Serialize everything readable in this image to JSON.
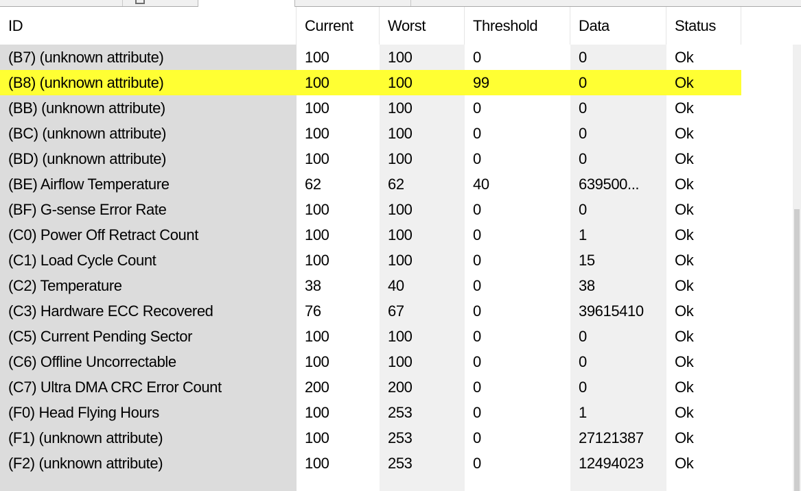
{
  "columns": [
    "ID",
    "Current",
    "Worst",
    "Threshold",
    "Data",
    "Status"
  ],
  "rows": [
    {
      "id": "(B7) (unknown attribute)",
      "current": "100",
      "worst": "100",
      "threshold": "0",
      "data": "0",
      "status": "Ok"
    },
    {
      "id": "(B8) (unknown attribute)",
      "current": "100",
      "worst": "100",
      "threshold": "99",
      "data": "0",
      "status": "Ok"
    },
    {
      "id": "(BB) (unknown attribute)",
      "current": "100",
      "worst": "100",
      "threshold": "0",
      "data": "0",
      "status": "Ok"
    },
    {
      "id": "(BC) (unknown attribute)",
      "current": "100",
      "worst": "100",
      "threshold": "0",
      "data": "0",
      "status": "Ok"
    },
    {
      "id": "(BD) (unknown attribute)",
      "current": "100",
      "worst": "100",
      "threshold": "0",
      "data": "0",
      "status": "Ok"
    },
    {
      "id": "(BE) Airflow Temperature",
      "current": "62",
      "worst": "62",
      "threshold": "40",
      "data": "639500...",
      "status": "Ok"
    },
    {
      "id": "(BF) G-sense Error Rate",
      "current": "100",
      "worst": "100",
      "threshold": "0",
      "data": "0",
      "status": "Ok"
    },
    {
      "id": "(C0) Power Off Retract Count",
      "current": "100",
      "worst": "100",
      "threshold": "0",
      "data": "1",
      "status": "Ok"
    },
    {
      "id": "(C1) Load Cycle Count",
      "current": "100",
      "worst": "100",
      "threshold": "0",
      "data": "15",
      "status": "Ok"
    },
    {
      "id": "(C2) Temperature",
      "current": "38",
      "worst": "40",
      "threshold": "0",
      "data": "38",
      "status": "Ok"
    },
    {
      "id": "(C3) Hardware ECC Recovered",
      "current": "76",
      "worst": "67",
      "threshold": "0",
      "data": "39615410",
      "status": "Ok"
    },
    {
      "id": "(C5) Current Pending Sector",
      "current": "100",
      "worst": "100",
      "threshold": "0",
      "data": "0",
      "status": "Ok"
    },
    {
      "id": "(C6) Offline Uncorrectable",
      "current": "100",
      "worst": "100",
      "threshold": "0",
      "data": "0",
      "status": "Ok"
    },
    {
      "id": "(C7) Ultra DMA CRC Error Count",
      "current": "200",
      "worst": "200",
      "threshold": "0",
      "data": "0",
      "status": "Ok"
    },
    {
      "id": "(F0) Head Flying Hours",
      "current": "100",
      "worst": "253",
      "threshold": "0",
      "data": "1",
      "status": "Ok"
    },
    {
      "id": "(F1) (unknown attribute)",
      "current": "100",
      "worst": "253",
      "threshold": "0",
      "data": "27121387",
      "status": "Ok"
    },
    {
      "id": "(F2) (unknown attribute)",
      "current": "100",
      "worst": "253",
      "threshold": "0",
      "data": "12494023",
      "status": "Ok"
    }
  ],
  "selected_row_index": 1,
  "colors": {
    "selected_row": "#ffff33",
    "id_column_bg": "#dcdcdc",
    "alt_column_bg": "#f0f0f0"
  }
}
